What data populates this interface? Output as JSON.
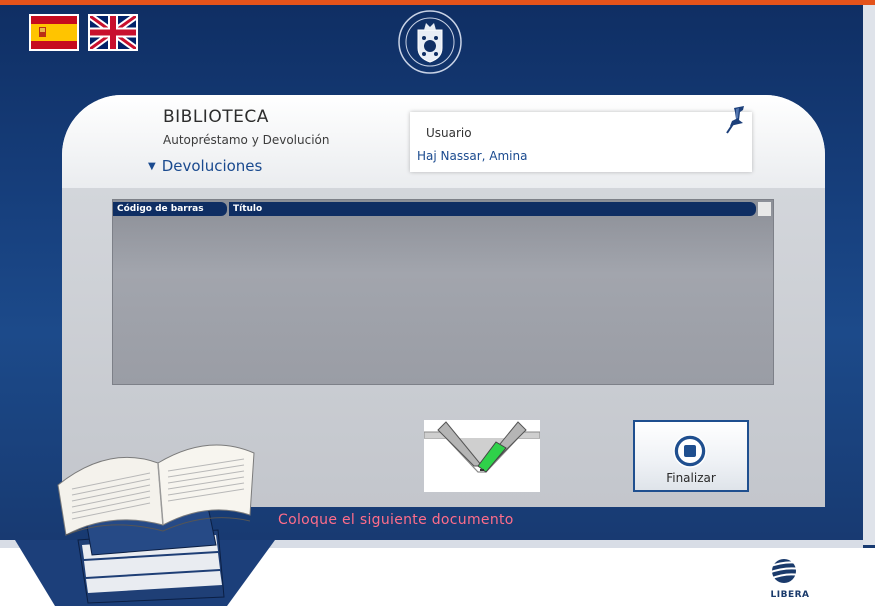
{
  "header": {
    "flags": [
      {
        "name": "Español"
      },
      {
        "name": "English"
      }
    ]
  },
  "panel": {
    "title": "BIBLIOTECA",
    "subtitle": "Autopréstamo y Devolución",
    "section": "Devoluciones"
  },
  "user": {
    "label": "Usuario",
    "name": "Haj Nassar, Amina"
  },
  "table": {
    "columns": [
      "Código de barras",
      "Título"
    ],
    "rows": []
  },
  "actions": {
    "finish_label": "Finalizar"
  },
  "status": {
    "message": "Coloque el siguiente documento"
  },
  "footer": {
    "brand": "LIBERA"
  },
  "colors": {
    "accent_top": "#e4531b",
    "navy": "#0f2e63",
    "status_text": "#ff6d8a",
    "link_blue": "#1a4a8f"
  }
}
